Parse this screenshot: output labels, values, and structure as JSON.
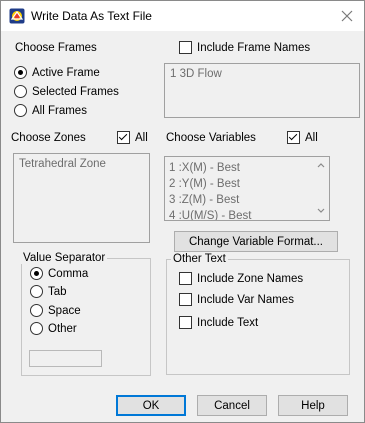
{
  "window": {
    "title": "Write Data As Text File"
  },
  "frames": {
    "heading": "Choose Frames",
    "options": [
      "Active Frame",
      "Selected Frames",
      "All Frames"
    ],
    "selected": "Active Frame",
    "include_names_label": "Include Frame Names",
    "include_names_checked": false,
    "list": [
      "1   3D Flow"
    ]
  },
  "zones": {
    "heading": "Choose Zones",
    "all_label": "All",
    "all_checked": true,
    "list": [
      "Tetrahedral Zone"
    ]
  },
  "variables": {
    "heading": "Choose Variables",
    "all_label": "All",
    "all_checked": true,
    "list": [
      "1 :X(M) - Best",
      "2 :Y(M) - Best",
      "3 :Z(M) - Best",
      "4 :U(M/S) - Best"
    ],
    "format_button": "Change Variable Format..."
  },
  "separator": {
    "heading": "Value Separator",
    "options": [
      "Comma",
      "Tab",
      "Space",
      "Other"
    ],
    "selected": "Comma",
    "other_value": ""
  },
  "other_text": {
    "heading": "Other Text",
    "options": [
      "Include Zone Names",
      "Include Var Names",
      "Include Text"
    ]
  },
  "buttons": {
    "ok": "OK",
    "cancel": "Cancel",
    "help": "Help"
  },
  "colors": {
    "accent": "#0078d7",
    "dialog_bg": "#f0f0f0",
    "disabled_text": "#6d6d6d"
  }
}
